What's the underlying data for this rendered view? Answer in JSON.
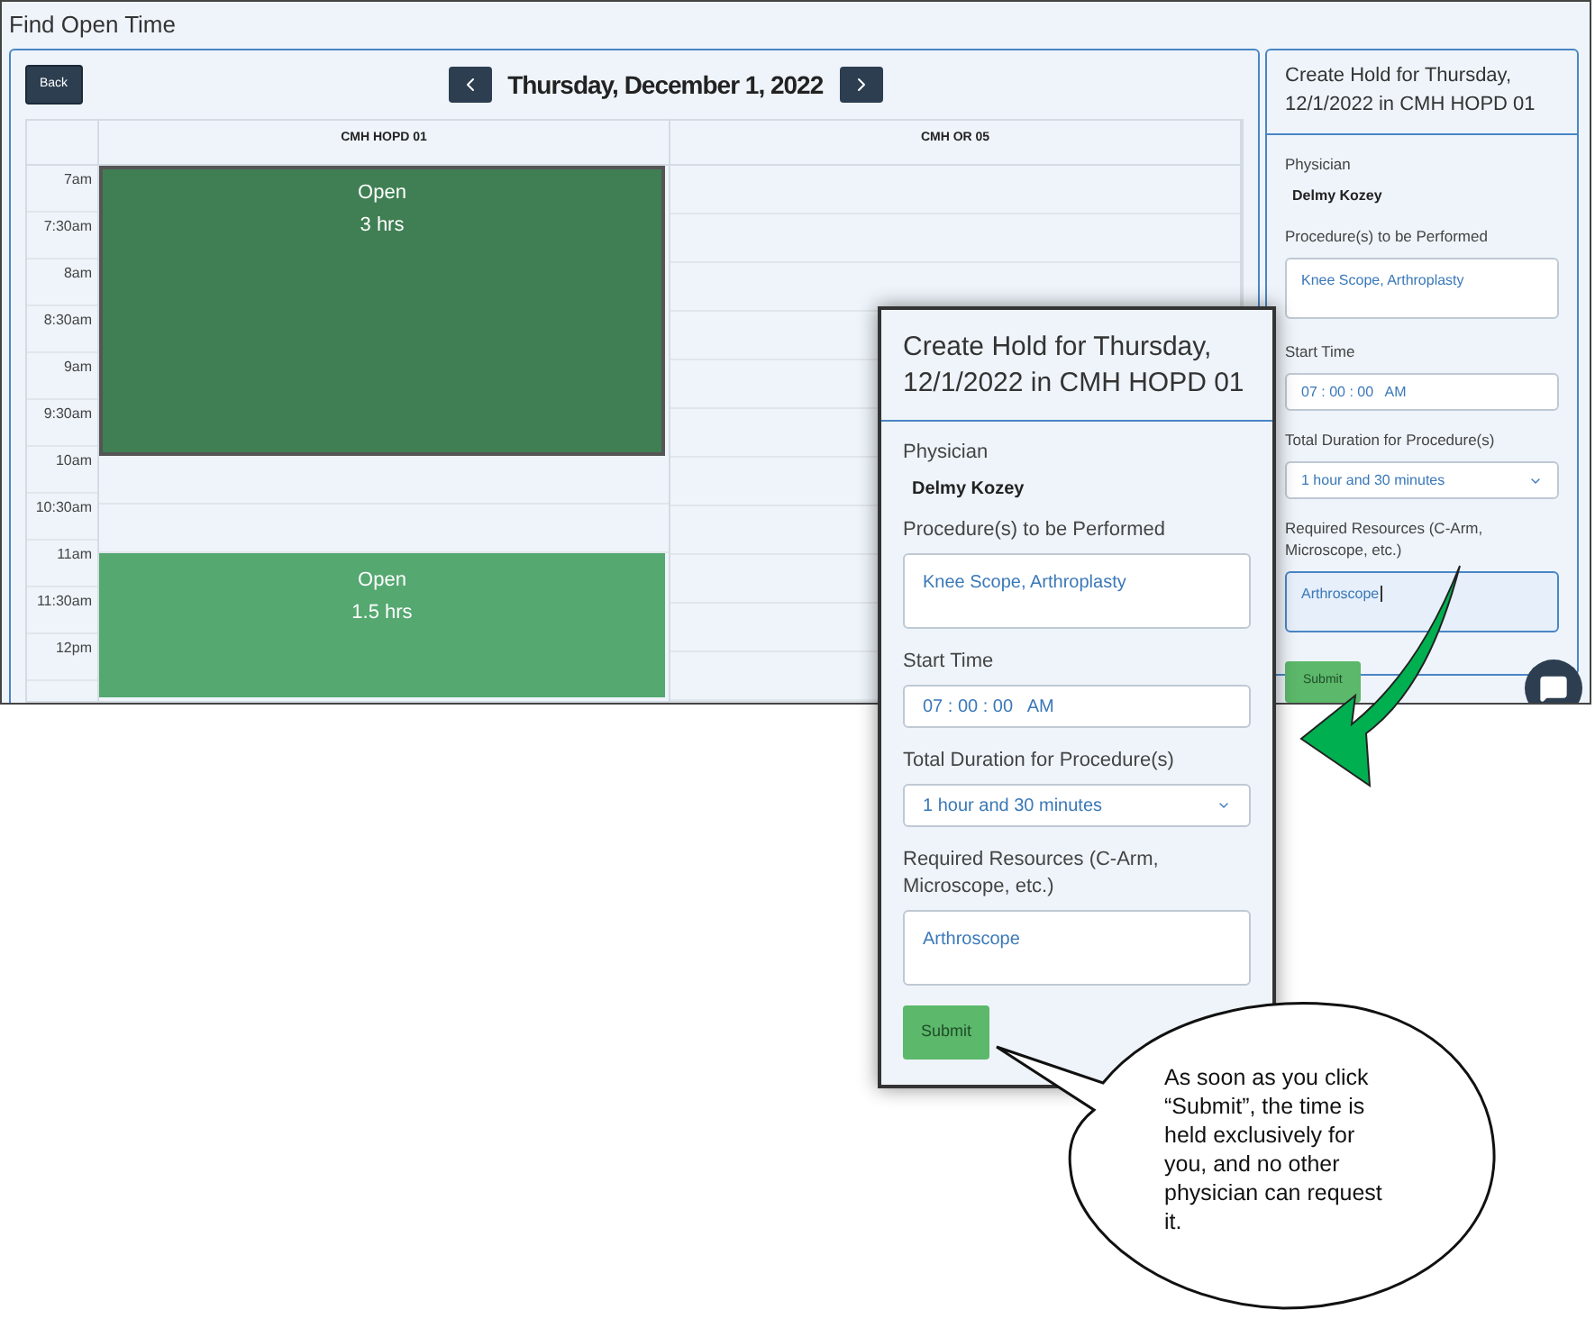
{
  "page_title": "Find Open Time",
  "toolbar": {
    "back": "Back",
    "date": "Thursday, December 1, 2022"
  },
  "calendar": {
    "columns": [
      "CMH HOPD 01",
      "CMH OR 05"
    ],
    "blocks": [
      {
        "kind": "open",
        "selected": true,
        "title": "Open",
        "duration": "3 hrs",
        "times": [
          "7am",
          "7:30am",
          "8am",
          "8:30am",
          "9am",
          "9:30am"
        ]
      },
      {
        "kind": "empty",
        "times": [
          "10am",
          "10:30am"
        ]
      },
      {
        "kind": "open",
        "selected": false,
        "title": "Open",
        "duration": "1.5 hrs",
        "times": [
          "11am",
          "11:30am",
          "12pm"
        ]
      }
    ]
  },
  "side_form": {
    "title": "Create Hold for Thursday, 12/1/2022 in CMH HOPD 01",
    "fields": [
      {
        "kind": "static",
        "label": "Physician",
        "value": "Delmy Kozey"
      },
      {
        "kind": "textarea",
        "label": "Procedure(s) to be Performed",
        "value": "Knee Scope, Arthroplasty",
        "focused": false
      },
      {
        "kind": "input",
        "label": "Start Time",
        "value": "07 : 00 : 00   AM",
        "focused": false
      },
      {
        "kind": "select",
        "label": "Total Duration for Procedure(s)",
        "value": "1 hour and 30 minutes",
        "focused": false
      },
      {
        "kind": "textarea",
        "label": "Required Resources (C-Arm, Microscope, etc.)",
        "value": "Arthroscope",
        "focused": true
      }
    ],
    "submit": "Submit"
  },
  "zoomed_form": {
    "title": "Create Hold for Thursday, 12/1/2022 in CMH HOPD 01",
    "fields": [
      {
        "kind": "static",
        "label": "Physician",
        "value": "Delmy Kozey"
      },
      {
        "kind": "textarea",
        "label": "Procedure(s) to be Performed",
        "value": "Knee Scope, Arthroplasty",
        "focused": false
      },
      {
        "kind": "input",
        "label": "Start Time",
        "value": "07 : 00 : 00   AM",
        "focused": false
      },
      {
        "kind": "select",
        "label": "Total Duration for Procedure(s)",
        "value": "1 hour and 30 minutes",
        "focused": false
      },
      {
        "kind": "textarea",
        "label": "Required Resources (C-Arm, Microscope, etc.)",
        "value": "Arthroscope",
        "focused": false
      }
    ],
    "submit": "Submit"
  },
  "callout": "As soon as you click “Submit”, the time is held exclusively for you, and no other physician can request it."
}
